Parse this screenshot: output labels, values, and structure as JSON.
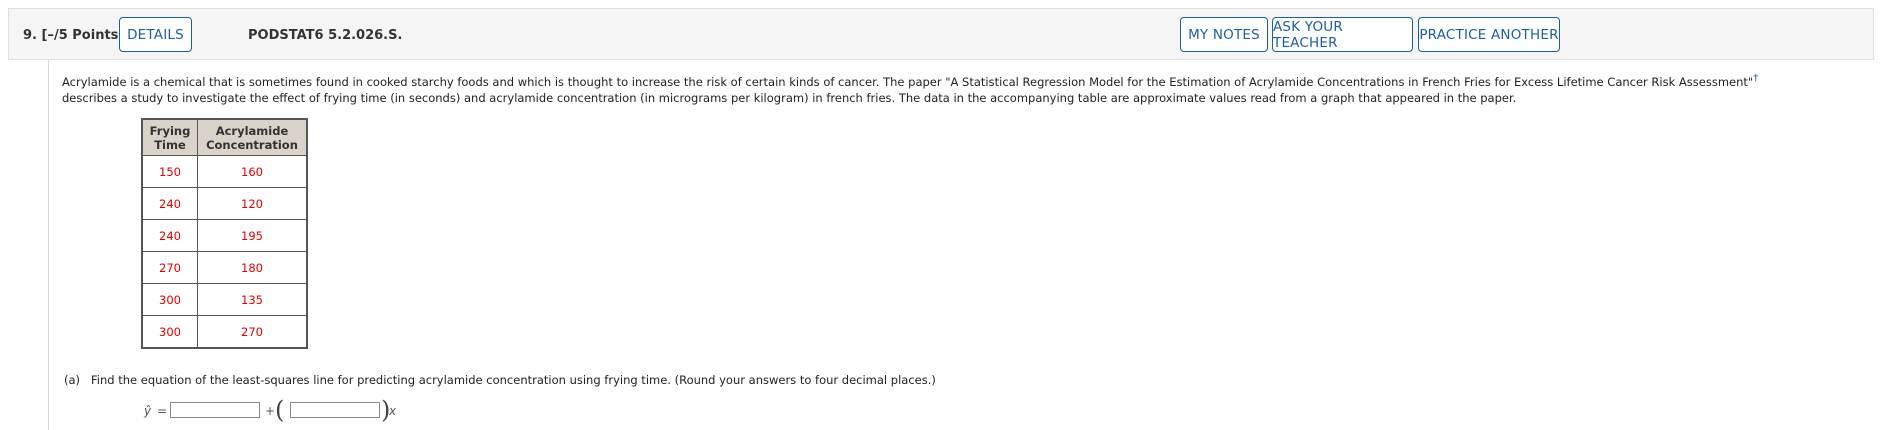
{
  "header": {
    "question_number": "9.",
    "points": "[–/5 Points]",
    "details_label": "DETAILS",
    "question_code": "PODSTAT6 5.2.026.S.",
    "my_notes_label": "MY NOTES",
    "ask_teacher_label": "ASK YOUR TEACHER",
    "practice_another_label": "PRACTICE ANOTHER"
  },
  "intro": {
    "line1": "Acrylamide is a chemical that is sometimes found in cooked starchy foods and which is thought to increase the risk of certain kinds of cancer. The paper \"A Statistical Regression Model for the Estimation of Acrylamide Concentrations in French Fries for Excess Lifetime Cancer Risk Assessment\"",
    "dagger": "†",
    "line2": "describes a study to investigate the effect of frying time (in seconds) and acrylamide concentration (in micrograms per kilogram) in french fries. The data in the accompanying table are approximate values read from a graph that appeared in the paper."
  },
  "table": {
    "headers": [
      "Frying Time",
      "Acrylamide Concentration"
    ],
    "rows": [
      [
        "150",
        "160"
      ],
      [
        "240",
        "120"
      ],
      [
        "240",
        "195"
      ],
      [
        "270",
        "180"
      ],
      [
        "300",
        "135"
      ],
      [
        "300",
        "270"
      ]
    ],
    "value_color": "#e00000"
  },
  "part_a": {
    "label": "(a)",
    "text": "Find the equation of the least-squares line for predicting acrylamide concentration using frying time. (Round your answers to four decimal places.)",
    "yhat": "ŷ",
    "equals": "=",
    "intercept_value": "",
    "plus": "+",
    "open_paren": "(",
    "slope_value": "",
    "close_paren": ")",
    "x": "x"
  },
  "colors": {
    "accent": "#1d5e9e",
    "header_bg": "#f5f5f5",
    "table_header_bg": "#d9d3ca"
  }
}
